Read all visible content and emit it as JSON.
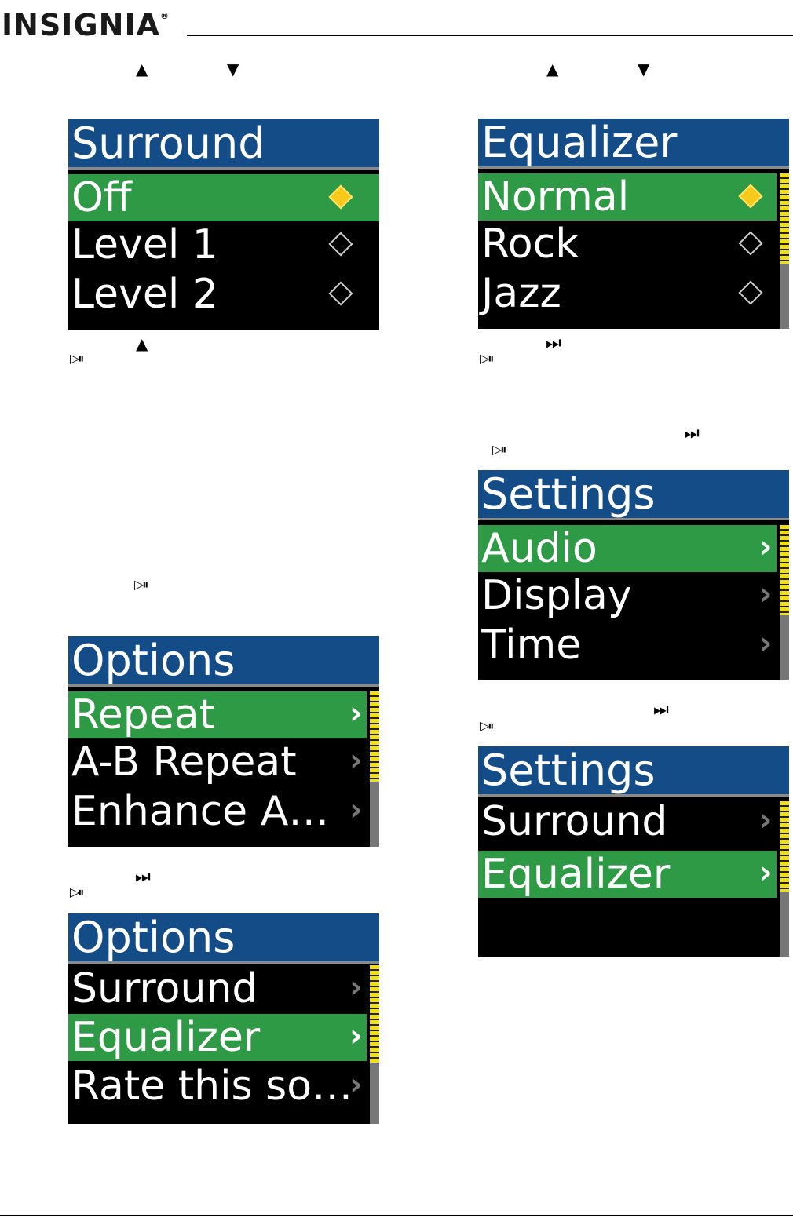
{
  "header": {
    "logo": "INSIGNIA",
    "logo_mark": "®"
  },
  "icons": {
    "up": "▲",
    "down": "▼",
    "play_pause": "▷⏸",
    "next": "⏭"
  },
  "screens": {
    "surround": {
      "title": "Surround",
      "items": [
        "Off",
        "Level 1",
        "Level 2"
      ],
      "selected": "Off"
    },
    "equalizer": {
      "title": "Equalizer",
      "items": [
        "Normal",
        "Rock",
        "Jazz"
      ],
      "selected": "Normal"
    },
    "options1": {
      "title": "Options",
      "items": [
        "Repeat",
        "A-B Repeat",
        "Enhance A…"
      ],
      "selected": "Repeat"
    },
    "options2": {
      "title": "Options",
      "items": [
        "Surround",
        "Equalizer",
        "Rate this so…"
      ],
      "selected": "Equalizer"
    },
    "settings1": {
      "title": "Settings",
      "items": [
        "Audio",
        "Display",
        "Time"
      ],
      "selected": "Audio"
    },
    "settings2": {
      "title": "Settings",
      "items": [
        "Surround",
        "Equalizer"
      ],
      "selected": "Equalizer"
    }
  }
}
